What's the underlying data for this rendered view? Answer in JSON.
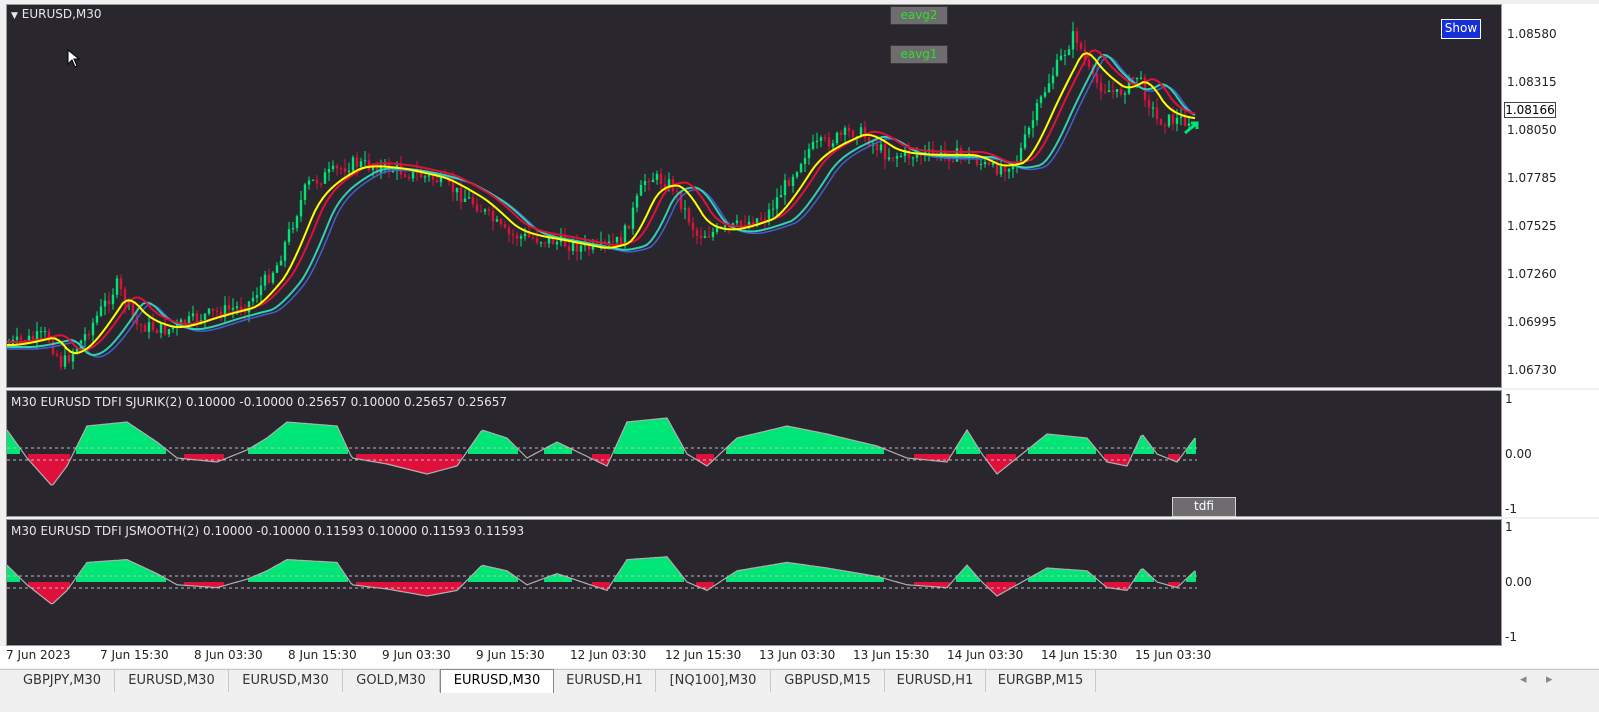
{
  "chart": {
    "symbol_label": "EURUSD,M30",
    "current_price": "1.08166",
    "price_ticks": [
      "1.08580",
      "1.08315",
      "1.08050",
      "1.07785",
      "1.07525",
      "1.07260",
      "1.06995",
      "1.06730"
    ],
    "buttons": {
      "eavg2": "eavg2",
      "eavg1": "eavg1",
      "show": "Show",
      "tdfi": "tdfi"
    },
    "indicator1": {
      "title": "M30 EURUSD TDFI  SJURIK(2) 0.10000 -0.10000 0.25657 0.10000 0.25657 0.25657",
      "ticks": [
        "1",
        "0.00",
        "-1"
      ]
    },
    "indicator2": {
      "title": "M30 EURUSD TDFI  JSMOOTH(2) 0.10000 -0.10000 0.11593 0.10000 0.11593 0.11593",
      "ticks": [
        "1",
        "0.00",
        "-1"
      ]
    },
    "time_labels": [
      "7 Jun 2023",
      "7 Jun 15:30",
      "8 Jun 03:30",
      "8 Jun 15:30",
      "9 Jun 03:30",
      "9 Jun 15:30",
      "12 Jun 03:30",
      "12 Jun 15:30",
      "13 Jun 03:30",
      "13 Jun 15:30",
      "14 Jun 03:30",
      "14 Jun 15:30",
      "15 Jun 03:30"
    ],
    "colors": {
      "background": "#29262e",
      "bull": "#00e676",
      "bear": "#e0103c",
      "ma_yellow": "#ffff00",
      "ma_red": "#e0103c",
      "ma_teal": "#30d0b0",
      "ma_blue": "#4060d0"
    }
  },
  "tabs": [
    {
      "label": "GBPJPY,M30",
      "active": false
    },
    {
      "label": "EURUSD,M30",
      "active": false
    },
    {
      "label": "EURUSD,M30",
      "active": false
    },
    {
      "label": "GOLD,M30",
      "active": false
    },
    {
      "label": "EURUSD,M30",
      "active": true
    },
    {
      "label": "EURUSD,H1",
      "active": false
    },
    {
      "label": "[NQ100],M30",
      "active": false
    },
    {
      "label": "GBPUSD,M15",
      "active": false
    },
    {
      "label": "EURUSD,H1",
      "active": false
    },
    {
      "label": "EURGBP,M15",
      "active": false
    }
  ],
  "tab_scroll": {
    "left": "◂",
    "right": "▸"
  }
}
